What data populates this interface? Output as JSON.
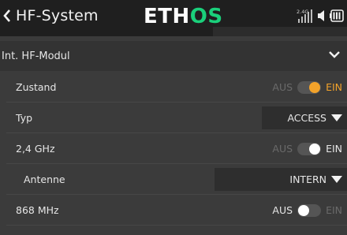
{
  "header": {
    "title": "HF-System",
    "brand_e": "ETH",
    "brand_o": "OS",
    "rf_band": "2.4G"
  },
  "section": {
    "label": "Int. HF-Modul"
  },
  "rows": {
    "zustand": {
      "label": "Zustand",
      "off": "AUS",
      "on": "EIN",
      "state": "on"
    },
    "typ": {
      "label": "Typ",
      "value": "ACCESS"
    },
    "ghz24": {
      "label": "2,4 GHz",
      "off": "AUS",
      "on": "EIN",
      "state": "on"
    },
    "antenne": {
      "label": "Antenne",
      "value": "INTERN"
    },
    "mhz868": {
      "label": "868 MHz",
      "off": "AUS",
      "on": "EIN",
      "state": "off"
    }
  },
  "colors": {
    "accent_orange": "#f2a22a",
    "brand_green": "#1ad07b"
  },
  "icons": [
    "back-arrow-icon",
    "signal-icon",
    "volume-icon",
    "battery-icon",
    "chevron-down-icon",
    "caret-down-icon"
  ]
}
